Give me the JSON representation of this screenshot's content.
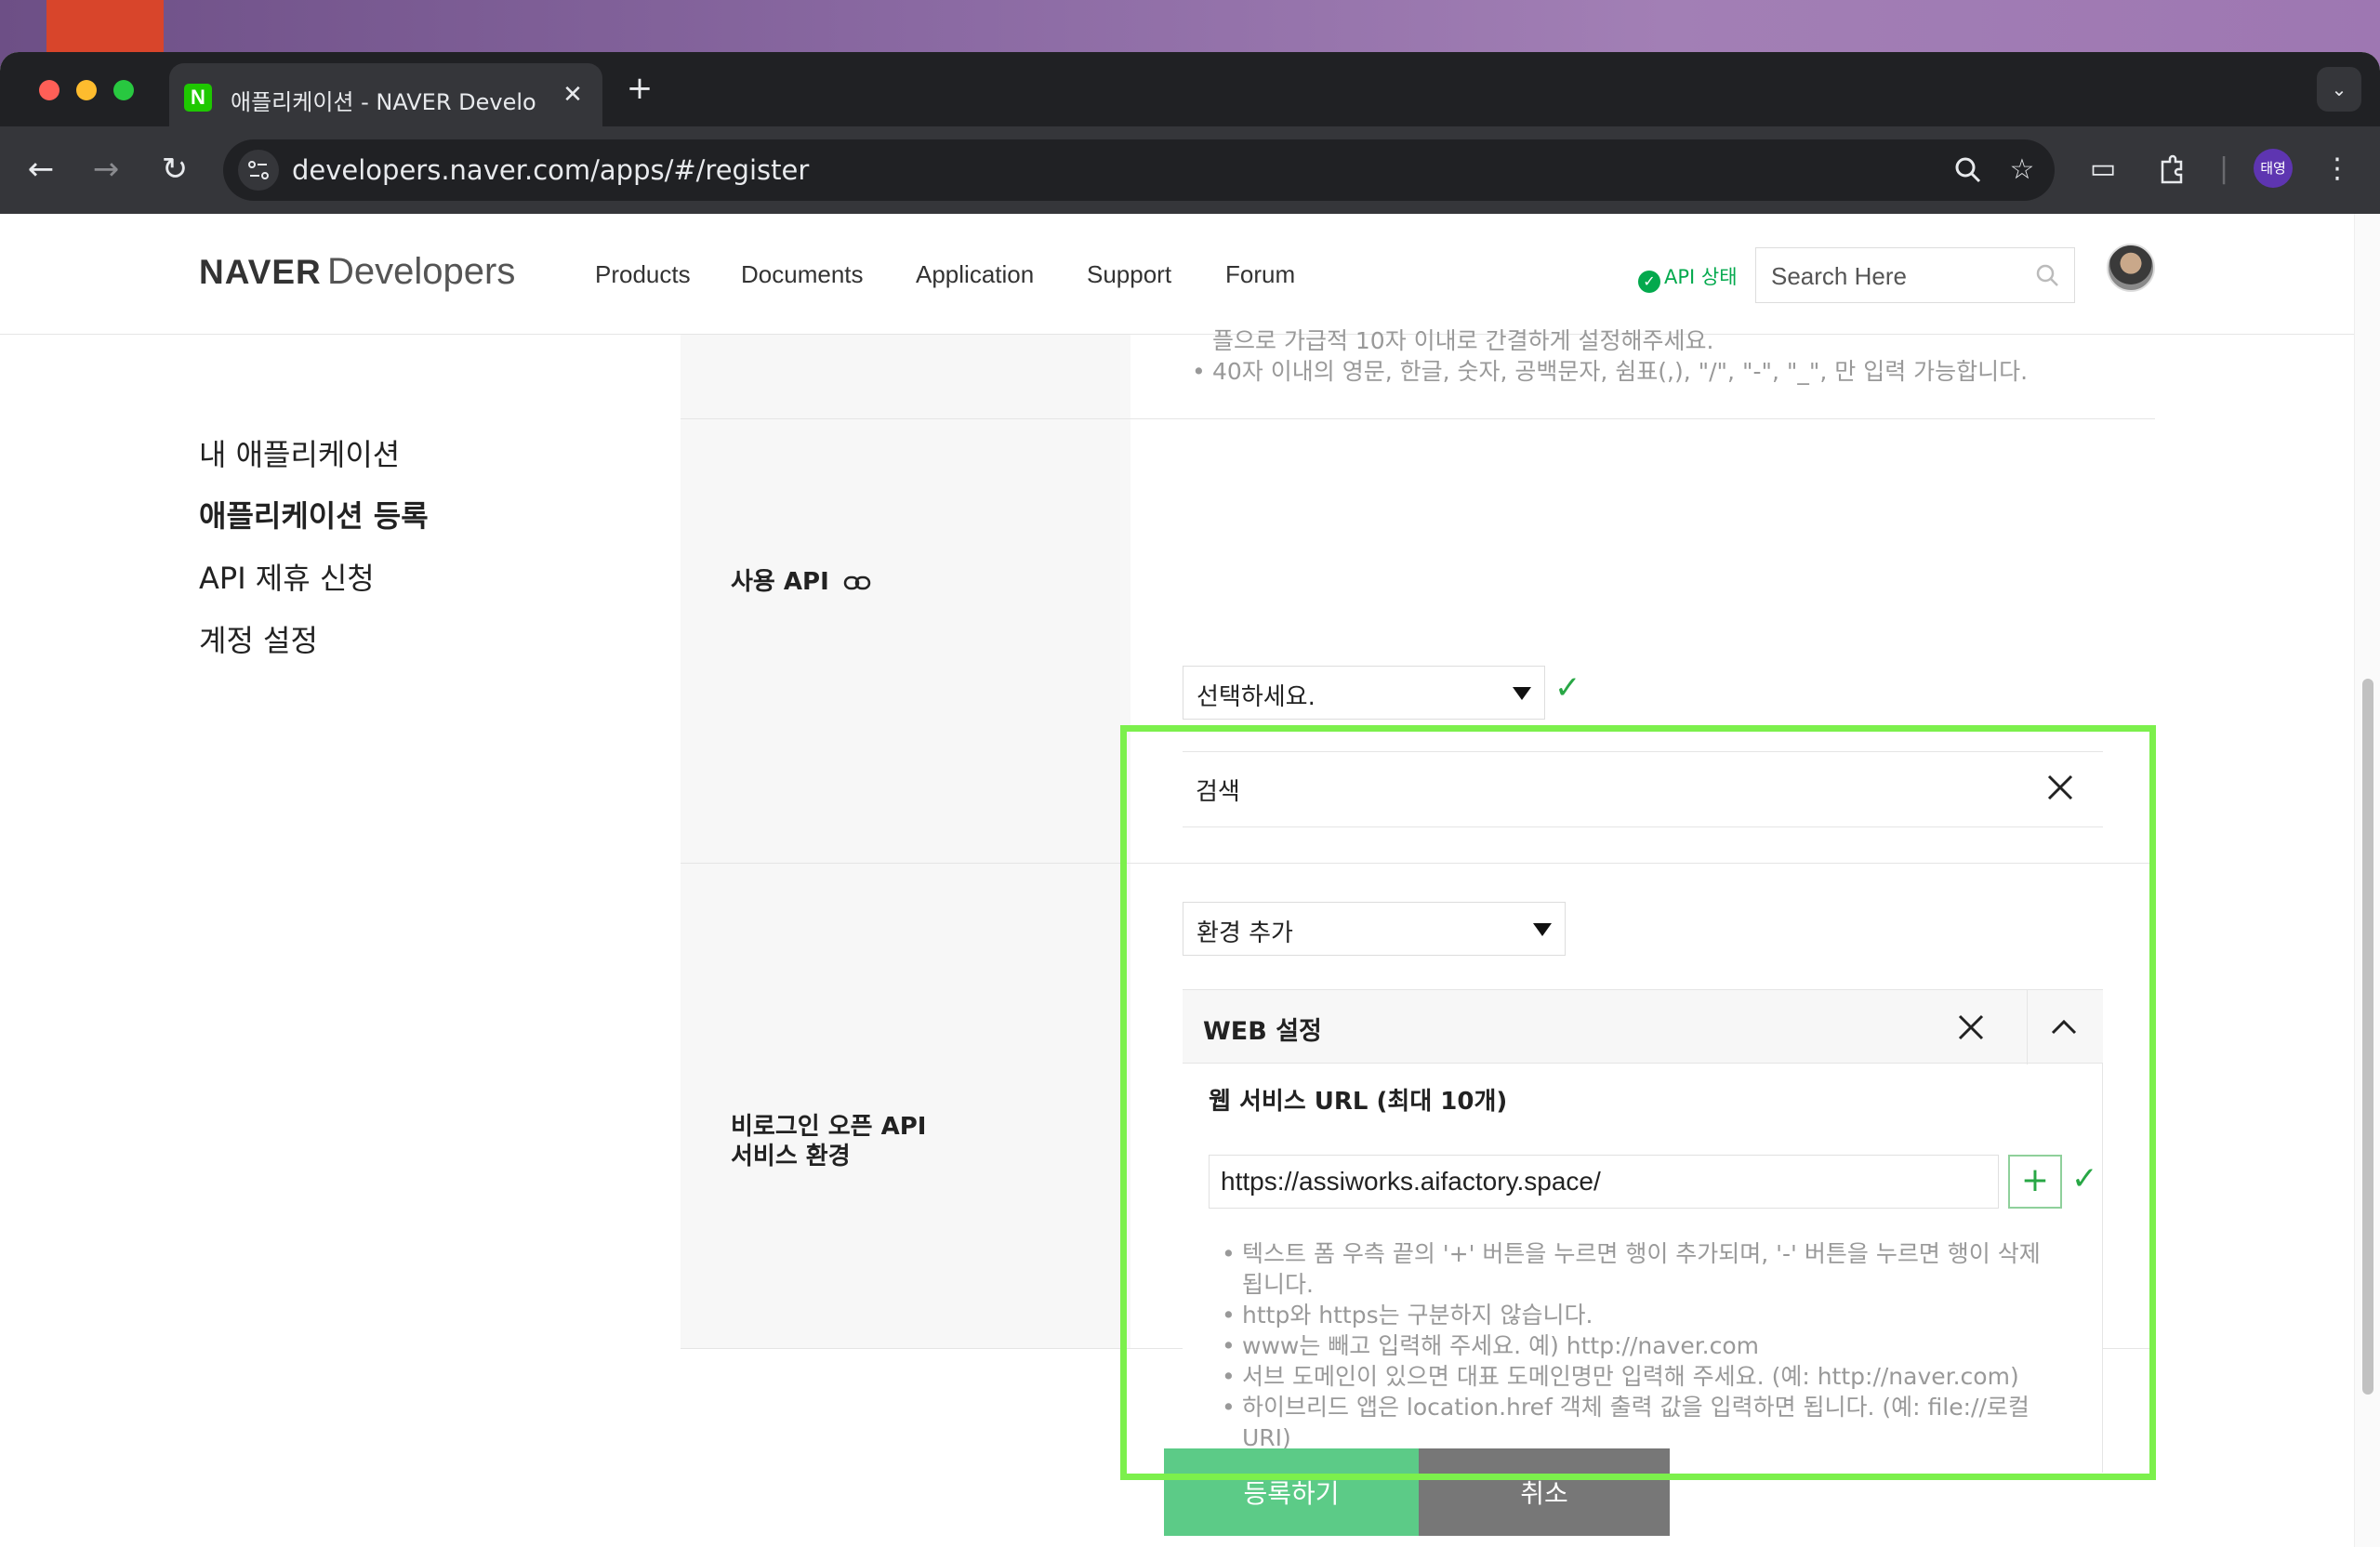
{
  "browser": {
    "tab_title": "애플리케이션 - NAVER Developers",
    "tab_favicon": "N",
    "new_tab": "+",
    "url": "developers.naver.com/apps/#/register",
    "profile_label": "태영",
    "traffic_colors": [
      "#ff5f57",
      "#febc2e",
      "#28c840"
    ]
  },
  "header": {
    "logo_bold": "NAVER",
    "logo_light": "Developers",
    "nav": [
      "Products",
      "Documents",
      "Application",
      "Support",
      "Forum"
    ],
    "api_status": "API 상태",
    "search_placeholder": "Search Here"
  },
  "sidebar": {
    "items": [
      {
        "label": "내 애플리케이션"
      },
      {
        "label": "애플리케이션 등록"
      },
      {
        "label": "API 제휴 신청"
      },
      {
        "label": "계정 설정"
      }
    ]
  },
  "form": {
    "top_hints": [
      "플으로 가급적 10자 이내로 간결하게 설정해주세요.",
      "40자 이내의 영문, 한글, 숫자, 공백문자, 쉼표(,), \"/\", \"-\", \"_\", 만 입력 가능합니다."
    ],
    "api": {
      "label": "사용 API",
      "select_value": "선택하세요.",
      "selected_chip": "검색"
    },
    "env": {
      "label_line1": "비로그인 오픈 API",
      "label_line2": "서비스 환경",
      "select_value": "환경 추가",
      "panel_title": "WEB 설정",
      "sub_title": "웹 서비스 URL (최대 10개)",
      "url_value": "https://assiworks.aifactory.space/",
      "hints": [
        "텍스트 폼 우측 끝의 '+' 버튼을 누르면 행이 추가되며, '-' 버튼을 누르면 행이 삭제됩니다.",
        "http와 https는 구분하지 않습니다.",
        "www는 빼고 입력해 주세요. 예) http://naver.com",
        "서브 도메인이 있으면 대표 도메인명만 입력해 주세요. (예: http://naver.com)",
        "하이브리드 앱은 location.href 객체 출력 값을 입력하면 됩니다. (예: file://로컬 URI)"
      ]
    }
  },
  "actions": {
    "submit": "등록하기",
    "cancel": "취소"
  },
  "colors": {
    "accent_green": "#5ccb87",
    "check_green": "#28a745",
    "highlight": "#7cf04c"
  }
}
